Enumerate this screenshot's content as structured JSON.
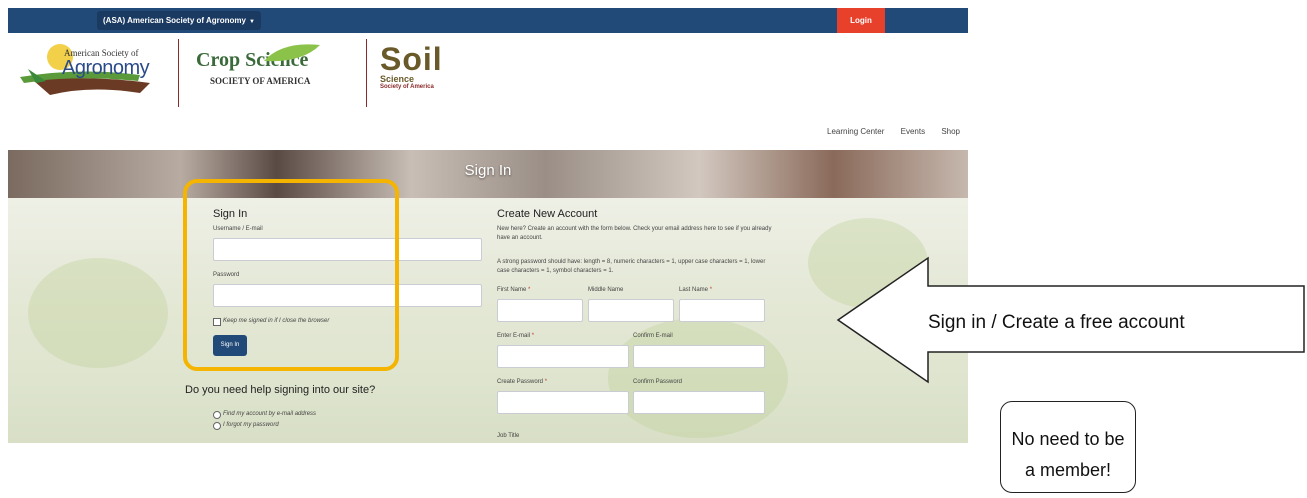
{
  "topbar": {
    "org_selector": "(ASA) American Society of Agronomy",
    "login_label": "Login"
  },
  "logos": {
    "asa_small": "American Society of",
    "asa_big": "Agronomy",
    "css_big": "Crop Science",
    "css_small": "SOCIETY OF AMERICA",
    "sss_big": "Soil",
    "sss_mid": "Science",
    "sss_small": "Society of America"
  },
  "nav": {
    "items": [
      "Learning Center",
      "Events",
      "Shop"
    ]
  },
  "hero": {
    "title": "Sign In"
  },
  "signin": {
    "heading": "Sign In",
    "username_label": "Username / E-mail",
    "password_label": "Password",
    "keep_signed_in": "Keep me signed in if I close the browser",
    "button_label": "Sign In"
  },
  "help": {
    "title": "Do you need help signing into our site?",
    "option1": "Find my account by e-mail address",
    "option2": "I forgot my password"
  },
  "create_account": {
    "heading": "Create New Account",
    "intro": "New here? Create an account with the form below. Check your email address here to see if you already have an account.",
    "password_rules": "A strong password should have: length = 8, numeric characters = 1, upper case characters = 1, lower case characters = 1, symbol characters = 1.",
    "first_name": "First Name",
    "middle_name": "Middle Name",
    "last_name": "Last Name",
    "enter_email": "Enter E-mail",
    "confirm_email": "Confirm E-mail",
    "create_password": "Create Password",
    "confirm_password": "Confirm Password",
    "job_title": "Job Title",
    "required_mark": "*"
  },
  "annotations": {
    "arrow_text": "Sign in / Create a free account",
    "member_line1": "No need to be",
    "member_line2": "a member!",
    "highlight_color": "#f5b400"
  },
  "colors": {
    "navy": "#224a78",
    "login_red": "#e8412b"
  }
}
